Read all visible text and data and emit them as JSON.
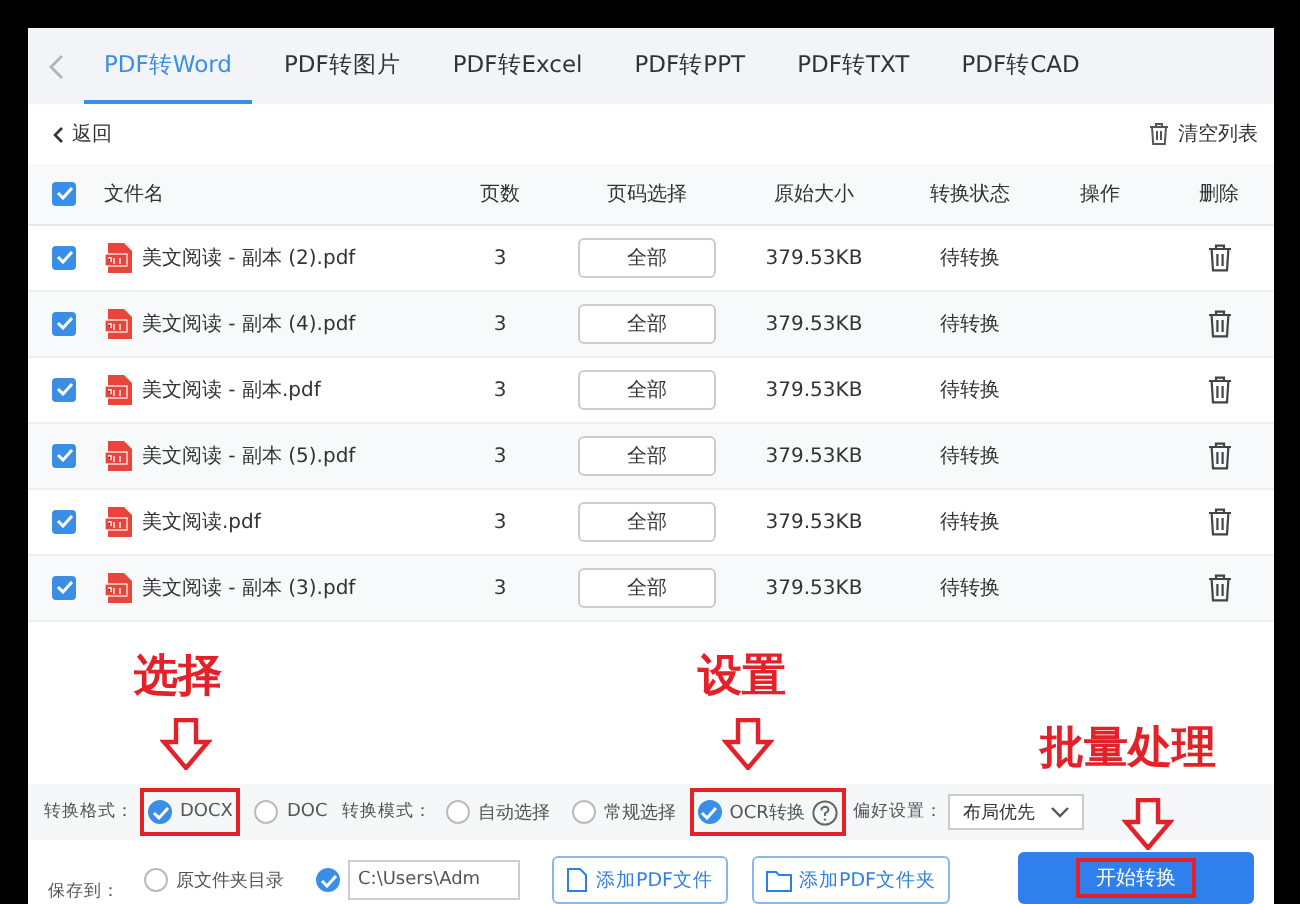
{
  "tabs": [
    {
      "label": "PDF转Word",
      "selected": true
    },
    {
      "label": "PDF转图片",
      "selected": false
    },
    {
      "label": "PDF转Excel",
      "selected": false
    },
    {
      "label": "PDF转PPT",
      "selected": false
    },
    {
      "label": "PDF转TXT",
      "selected": false
    },
    {
      "label": "PDF转CAD",
      "selected": false
    }
  ],
  "toolbar": {
    "back": "返回",
    "clear": "清空列表"
  },
  "table": {
    "select_all_checked": true,
    "columns": [
      "文件名",
      "页数",
      "页码选择",
      "原始大小",
      "转换状态",
      "操作",
      "删除"
    ],
    "rows": [
      {
        "checked": true,
        "name": "美文阅读 - 副本 (2).pdf",
        "pages": "3",
        "range": "全部",
        "size": "379.53KB",
        "status": "待转换"
      },
      {
        "checked": true,
        "name": "美文阅读 - 副本 (4).pdf",
        "pages": "3",
        "range": "全部",
        "size": "379.53KB",
        "status": "待转换"
      },
      {
        "checked": true,
        "name": "美文阅读 - 副本.pdf",
        "pages": "3",
        "range": "全部",
        "size": "379.53KB",
        "status": "待转换"
      },
      {
        "checked": true,
        "name": "美文阅读 - 副本 (5).pdf",
        "pages": "3",
        "range": "全部",
        "size": "379.53KB",
        "status": "待转换"
      },
      {
        "checked": true,
        "name": "美文阅读.pdf",
        "pages": "3",
        "range": "全部",
        "size": "379.53KB",
        "status": "待转换"
      },
      {
        "checked": true,
        "name": "美文阅读 - 副本 (3).pdf",
        "pages": "3",
        "range": "全部",
        "size": "379.53KB",
        "status": "待转换"
      }
    ]
  },
  "options": {
    "format_label": "转换格式：",
    "formats": [
      {
        "label": "DOCX",
        "selected": true,
        "highlighted": true
      },
      {
        "label": "DOC",
        "selected": false,
        "highlighted": false
      }
    ],
    "mode_label": "转换模式：",
    "modes": [
      {
        "label": "自动选择",
        "selected": false,
        "help": false,
        "highlighted": false
      },
      {
        "label": "常规选择",
        "selected": false,
        "help": false,
        "highlighted": false
      },
      {
        "label": "OCR转换",
        "selected": true,
        "help": true,
        "highlighted": true
      }
    ],
    "preference_label": "偏好设置：",
    "preference_value": "布局优先"
  },
  "save": {
    "label": "保存到：",
    "choices": [
      {
        "kind": "text",
        "label": "原文件夹目录",
        "selected": false
      },
      {
        "kind": "path",
        "value": "C:\\Users\\Adm",
        "selected": true
      }
    ],
    "buttons": [
      "添加PDF文件",
      "添加PDF文件夹"
    ],
    "start": "开始转换",
    "start_highlighted": true
  },
  "annotations": [
    {
      "text": "选择"
    },
    {
      "text": "设置"
    },
    {
      "text": "批量处理"
    }
  ]
}
